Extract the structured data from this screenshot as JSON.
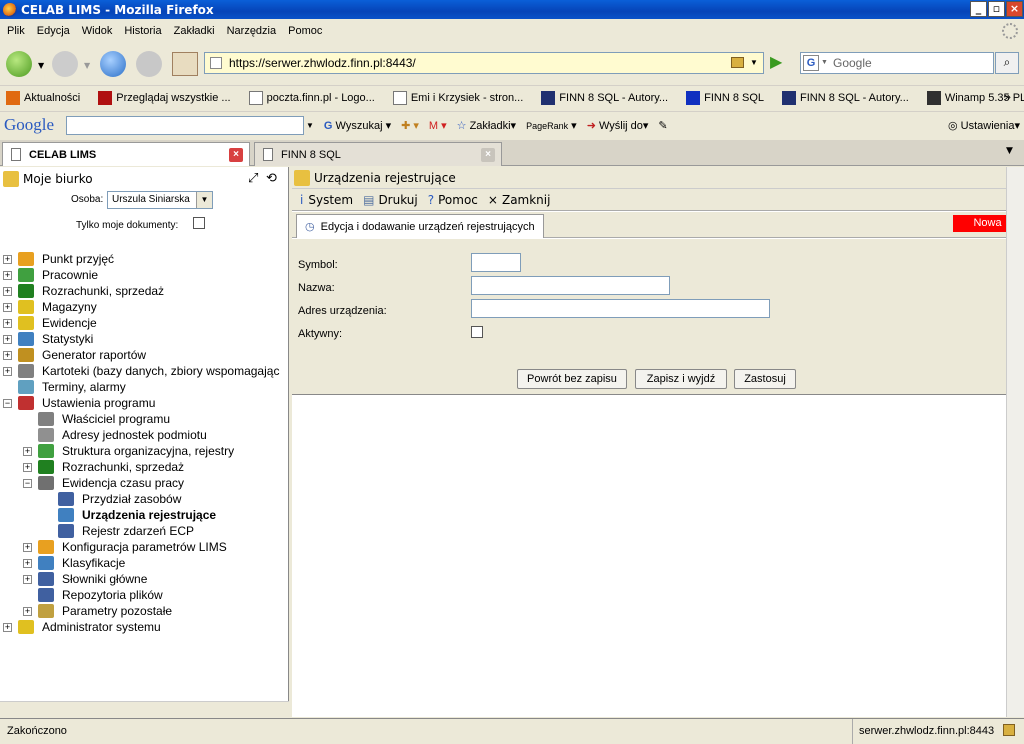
{
  "window": {
    "title": "CELAB LIMS - Mozilla Firefox"
  },
  "menu": [
    "Plik",
    "Edycja",
    "Widok",
    "Historia",
    "Zakładki",
    "Narzędzia",
    "Pomoc"
  ],
  "nav": {
    "url": "https://serwer.zhwlodz.finn.pl:8443/",
    "search_placeholder": "Google"
  },
  "bookmarks": [
    {
      "label": "Aktualności",
      "color": "#e05a10"
    },
    {
      "label": "Przeglądaj wszystkie ...",
      "color": "#b01010"
    },
    {
      "label": "poczta.finn.pl - Logo...",
      "color": "#ffffff"
    },
    {
      "label": "Emi i Krzysiek - stron...",
      "color": "#ffffff"
    },
    {
      "label": "FINN 8 SQL - Autory...",
      "color": "#203070"
    },
    {
      "label": "FINN 8 SQL",
      "color": "#1030c0"
    },
    {
      "label": "FINN 8 SQL - Autory...",
      "color": "#203070"
    },
    {
      "label": "Winamp 5.35 PL",
      "color": "#303030"
    }
  ],
  "google_toolbar": {
    "logo": "Google",
    "search_label": "Wyszukaj",
    "bookmarks_label": "Zakładki",
    "pagerank_label": "PageRank",
    "send_label": "Wyślij do",
    "settings_label": "Ustawienia"
  },
  "tabs": [
    {
      "label": "CELAB LIMS",
      "active": true
    },
    {
      "label": "FINN 8 SQL",
      "active": false
    }
  ],
  "left": {
    "title": "Moje biurko",
    "osoba_label": "Osoba:",
    "osoba_value": "Urszula Siniarska",
    "tylko_label": "Tylko moje dokumenty:",
    "tree": [
      {
        "label": "Punkt przyjęć",
        "level": 0,
        "pm": "+",
        "color": "#e8a020"
      },
      {
        "label": "Pracownie",
        "level": 0,
        "pm": "+",
        "color": "#40a040"
      },
      {
        "label": "Rozrachunki, sprzedaż",
        "level": 0,
        "pm": "+",
        "color": "#208020"
      },
      {
        "label": "Magazyny",
        "level": 0,
        "pm": "+",
        "color": "#e0c020"
      },
      {
        "label": "Ewidencje",
        "level": 0,
        "pm": "+",
        "color": "#e0c020"
      },
      {
        "label": "Statystyki",
        "level": 0,
        "pm": "+",
        "color": "#4080c0"
      },
      {
        "label": "Generator raportów",
        "level": 0,
        "pm": "+",
        "color": "#c09020"
      },
      {
        "label": "Kartoteki (bazy danych, zbiory wspomagając",
        "level": 0,
        "pm": "+",
        "color": "#808080"
      },
      {
        "label": "Terminy, alarmy",
        "level": 0,
        "pm": "",
        "color": "#60a0c0"
      },
      {
        "label": "Ustawienia programu",
        "level": 0,
        "pm": "−",
        "color": "#c03030"
      },
      {
        "label": "Właściciel programu",
        "level": 1,
        "pm": "",
        "color": "#808080"
      },
      {
        "label": "Adresy jednostek podmiotu",
        "level": 1,
        "pm": "",
        "color": "#909090"
      },
      {
        "label": "Struktura organizacyjna, rejestry",
        "level": 1,
        "pm": "+",
        "color": "#40a040"
      },
      {
        "label": "Rozrachunki, sprzedaż",
        "level": 1,
        "pm": "+",
        "color": "#208020"
      },
      {
        "label": "Ewidencja czasu pracy",
        "level": 1,
        "pm": "−",
        "color": "#707070"
      },
      {
        "label": "Przydział zasobów",
        "level": 2,
        "pm": "",
        "color": "#4060a0"
      },
      {
        "label": "Urządzenia rejestrujące",
        "level": 2,
        "pm": "",
        "color": "#4080c0",
        "bold": true
      },
      {
        "label": "Rejestr zdarzeń ECP",
        "level": 2,
        "pm": "",
        "color": "#4060a0"
      },
      {
        "label": "Konfiguracja parametrów LIMS",
        "level": 1,
        "pm": "+",
        "color": "#e8a020"
      },
      {
        "label": "Klasyfikacje",
        "level": 1,
        "pm": "+",
        "color": "#4080c0"
      },
      {
        "label": "Słowniki główne",
        "level": 1,
        "pm": "+",
        "color": "#4060a0"
      },
      {
        "label": "Repozytoria plików",
        "level": 1,
        "pm": "",
        "color": "#4060a0"
      },
      {
        "label": "Parametry pozostałe",
        "level": 1,
        "pm": "+",
        "color": "#c0a040"
      },
      {
        "label": "Administrator systemu",
        "level": 0,
        "pm": "+",
        "color": "#e0c020"
      }
    ]
  },
  "right": {
    "title": "Urządzenia rejestrujące",
    "toolbar": {
      "system": "System",
      "print": "Drukuj",
      "help": "Pomoc",
      "close": "Zamknij"
    },
    "tab_label": "Edycja i dodawanie urządzeń rejestrujących",
    "badge": "Nowa",
    "form": {
      "symbol_label": "Symbol:",
      "nazwa_label": "Nazwa:",
      "adres_label": "Adres urządzenia:",
      "aktywny_label": "Aktywny:"
    },
    "buttons": {
      "back": "Powrót bez zapisu",
      "save_exit": "Zapisz i wyjdź",
      "apply": "Zastosuj"
    }
  },
  "status": {
    "left": "Zakończono",
    "right": "serwer.zhwlodz.finn.pl:8443"
  }
}
